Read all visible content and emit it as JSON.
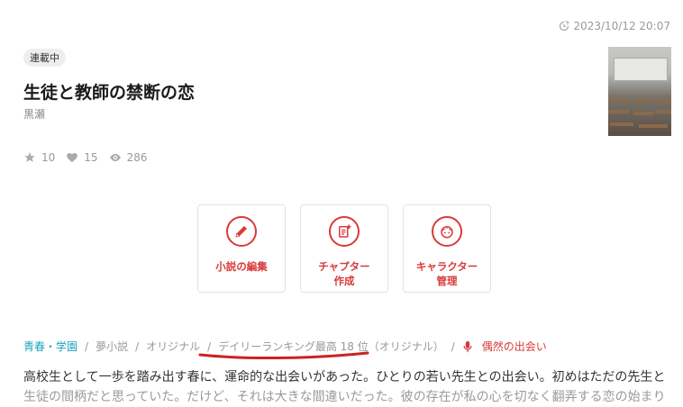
{
  "meta": {
    "updated": "2023/10/12 20:07"
  },
  "status_badge": "連載中",
  "title": "生徒と教師の禁断の恋",
  "author": "黒瀬",
  "stats": {
    "stars": "10",
    "likes": "15",
    "views": "286"
  },
  "actions": [
    {
      "label": "小説の編集",
      "icon": "pencil-icon"
    },
    {
      "label": "チャプター\n作成",
      "icon": "add-document-icon"
    },
    {
      "label": "キャラクター\n管理",
      "icon": "character-face-icon"
    }
  ],
  "tags": {
    "genre": "青春・学園",
    "type": "夢小説",
    "original": "オリジナル",
    "ranking": "デイリーランキング最高 18 位（オリジナル）",
    "keyword": "偶然の出会い"
  },
  "description": {
    "line1": "高校生として一歩を踏み出す春に、運命的な出会いがあった。ひとりの若い先生との出会い。初めはただの先生と",
    "line2": "生徒の間柄だと思っていた。だけど、それは大きな間違いだった。彼の存在が私の心を切なく翻弄する恋の始まり"
  },
  "colors": {
    "accent": "#d93a3a",
    "genre": "#1aa3c4",
    "annotation": "#cc2222"
  }
}
